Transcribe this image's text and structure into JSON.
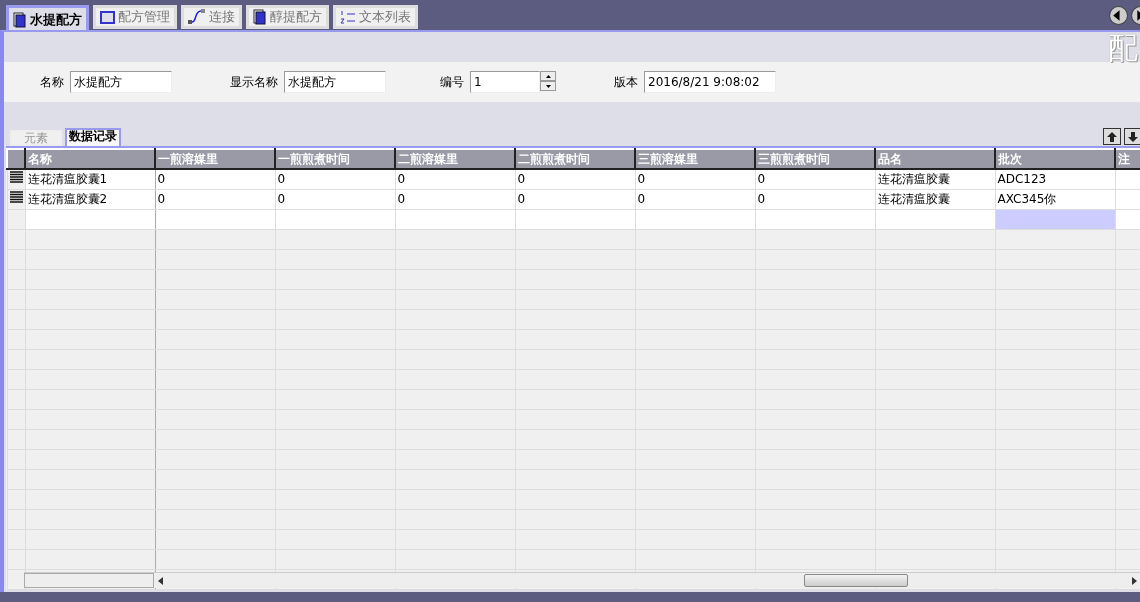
{
  "tabs": [
    {
      "label": "水提配方",
      "selected": true
    },
    {
      "label": "配方管理",
      "selected": false
    },
    {
      "label": "连接",
      "selected": false
    },
    {
      "label": "醇提配方",
      "selected": false
    },
    {
      "label": "文本列表",
      "selected": false
    }
  ],
  "page_title": "配",
  "form": {
    "fields": [
      {
        "label": "名称",
        "value": "水提配方",
        "kind": "text"
      },
      {
        "label": "显示名称",
        "value": "水提配方",
        "kind": "text"
      },
      {
        "label": "编号",
        "value": "1",
        "kind": "spin"
      },
      {
        "label": "版本",
        "value": "2016/8/21 9:08:02",
        "kind": "text"
      }
    ]
  },
  "subtabs": [
    {
      "label": "元素",
      "selected": false
    },
    {
      "label": "数据记录",
      "selected": true
    }
  ],
  "table": {
    "columns": [
      "名称",
      "一煎溶媒里",
      "一煎煎煮时间",
      "二煎溶媒里",
      "二煎煎煮时间",
      "三煎溶媒里",
      "三煎煎煮时间",
      "品名",
      "批次",
      "注"
    ],
    "rows": [
      {
        "cells": [
          "连花清瘟胶囊1",
          "0",
          "0",
          "0",
          "0",
          "0",
          "0",
          "连花清瘟胶囊",
          "ADC123",
          ""
        ]
      },
      {
        "cells": [
          "连花清瘟胶囊2",
          "0",
          "0",
          "0",
          "0",
          "0",
          "0",
          "连花清瘟胶囊",
          "AXC345你",
          ""
        ]
      }
    ],
    "new_row": [
      {
        "selected": false
      },
      {
        "selected": false
      },
      {
        "selected": false
      },
      {
        "selected": false
      },
      {
        "selected": false
      },
      {
        "selected": false
      },
      {
        "selected": false
      },
      {
        "selected": false
      },
      {
        "selected": true
      },
      {
        "selected": false
      }
    ]
  }
}
